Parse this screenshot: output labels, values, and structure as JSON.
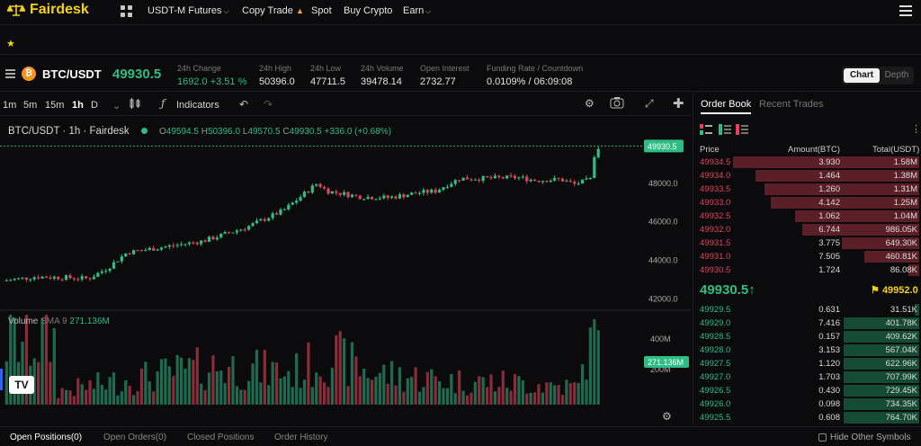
{
  "brand": {
    "name": "Fairdesk"
  },
  "nav": {
    "items": [
      {
        "label": "USDT-M Futures",
        "has_menu": true
      },
      {
        "label": "Copy Trade",
        "badge_icon": "fire-icon"
      },
      {
        "label": "Spot"
      },
      {
        "label": "Buy Crypto"
      },
      {
        "label": "Earn",
        "has_menu": true
      }
    ]
  },
  "ticker": {
    "pair": "BTC/USDT",
    "last_price": "49930.5",
    "stats": [
      {
        "label": "24h Change",
        "value": "1692.0 +3.51 %"
      },
      {
        "label": "24h High",
        "value": "50396.0"
      },
      {
        "label": "24h Low",
        "value": "47711.5"
      },
      {
        "label": "24h Volume",
        "value": "39478.14"
      },
      {
        "label": "Open Interest",
        "value": "2732.77"
      },
      {
        "label": "Funding Rate / Countdown",
        "value": "0.0109% / 06:09:08"
      }
    ],
    "view_toggle": {
      "active": "Chart",
      "inactive": "Depth"
    }
  },
  "toolbar": {
    "timeframes": [
      "1m",
      "5m",
      "15m",
      "1h",
      "D"
    ],
    "active_timeframe": "1h",
    "indicators_label": "Indicators"
  },
  "chart": {
    "title": "BTC/USDT · 1h · Fairdesk",
    "ohlc": {
      "o": "49594.5",
      "h": "50396.0",
      "l": "49570.5",
      "c": "49930.5",
      "change": "+336.0 (+0.68%)"
    },
    "price_tag": "49930.5",
    "volume_tag": "271.136M",
    "volume_label": "Volume",
    "volume_sma": "SMA 9",
    "volume_value": "271.136M",
    "tv_logo": "TV",
    "colors": {
      "up": "#2ebd85",
      "down": "#e0445b"
    }
  },
  "chart_data": {
    "type": "candlestick",
    "price_axis_ticks": [
      "48000.0",
      "46000.0",
      "44000.0",
      "42000.0"
    ],
    "volume_axis_ticks": [
      "400M",
      "200M"
    ],
    "x_ticks": [
      "7",
      "8",
      "9",
      "10",
      "11",
      "12",
      "13"
    ],
    "ylim": [
      41600,
      50600
    ],
    "xlim": [
      6.45,
      13.15
    ],
    "anchors": [
      [
        6.47,
        42950
      ],
      [
        6.8,
        43150
      ],
      [
        7.15,
        43100
      ],
      [
        7.35,
        43050
      ],
      [
        7.55,
        43600
      ],
      [
        7.75,
        44400
      ],
      [
        8.15,
        44700
      ],
      [
        8.55,
        45000
      ],
      [
        9.0,
        45700
      ],
      [
        9.4,
        46600
      ],
      [
        9.6,
        47400
      ],
      [
        9.75,
        48000
      ],
      [
        9.85,
        47600
      ],
      [
        10.2,
        47300
      ],
      [
        10.5,
        47250
      ],
      [
        10.8,
        47500
      ],
      [
        11.0,
        47600
      ],
      [
        11.1,
        47900
      ],
      [
        11.25,
        48250
      ],
      [
        11.5,
        48250
      ],
      [
        11.85,
        48300
      ],
      [
        12.05,
        48150
      ],
      [
        12.3,
        48200
      ],
      [
        12.45,
        47950
      ],
      [
        12.62,
        48200
      ],
      [
        12.66,
        49500
      ],
      [
        12.72,
        49930.5
      ]
    ],
    "volume_series": [
      [
        7.0,
        60
      ],
      [
        7.8,
        120
      ],
      [
        8.7,
        180
      ],
      [
        9.5,
        150
      ],
      [
        9.9,
        230
      ],
      [
        10.3,
        150
      ],
      [
        11.2,
        110
      ],
      [
        12.0,
        100
      ],
      [
        12.5,
        80
      ],
      [
        12.62,
        380
      ],
      [
        12.68,
        300
      ]
    ]
  },
  "order_book": {
    "tabs": [
      "Order Book",
      "Recent Trades"
    ],
    "headers": [
      "Price",
      "Amount(BTC)",
      "Total(USDT)"
    ],
    "asks": [
      {
        "price": "49934.5",
        "amount": "3.930",
        "total": "1.58M",
        "depth": 0.84
      },
      {
        "price": "49934.0",
        "amount": "1.464",
        "total": "1.38M",
        "depth": 0.74
      },
      {
        "price": "49933.5",
        "amount": "1.260",
        "total": "1.31M",
        "depth": 0.7
      },
      {
        "price": "49933.0",
        "amount": "4.142",
        "total": "1.25M",
        "depth": 0.67
      },
      {
        "price": "49932.5",
        "amount": "1.062",
        "total": "1.04M",
        "depth": 0.56
      },
      {
        "price": "49932.0",
        "amount": "6.744",
        "total": "986.05K",
        "depth": 0.53
      },
      {
        "price": "49931.5",
        "amount": "3.775",
        "total": "649.30K",
        "depth": 0.35
      },
      {
        "price": "49931.0",
        "amount": "7.505",
        "total": "460.81K",
        "depth": 0.25
      },
      {
        "price": "49930.5",
        "amount": "1.724",
        "total": "86.08K",
        "depth": 0.05
      }
    ],
    "mid_price": "49930.5↑",
    "mark_price": "49952.0",
    "bids": [
      {
        "price": "49929.5",
        "amount": "0.631",
        "total": "31.51K",
        "depth": 0.02
      },
      {
        "price": "49929.0",
        "amount": "7.416",
        "total": "401.78K",
        "depth": 0.34
      },
      {
        "price": "49928.5",
        "amount": "0.157",
        "total": "409.62K",
        "depth": 0.34
      },
      {
        "price": "49928.0",
        "amount": "3.153",
        "total": "567.04K",
        "depth": 0.34
      },
      {
        "price": "49927.5",
        "amount": "1.120",
        "total": "622.96K",
        "depth": 0.34
      },
      {
        "price": "49927.0",
        "amount": "1.703",
        "total": "707.99K",
        "depth": 0.34
      },
      {
        "price": "49926.5",
        "amount": "0.430",
        "total": "729.45K",
        "depth": 0.34
      },
      {
        "price": "49926.0",
        "amount": "0.098",
        "total": "734.35K",
        "depth": 0.34
      },
      {
        "price": "49925.5",
        "amount": "0.608",
        "total": "764.70K",
        "depth": 0.34
      }
    ]
  },
  "bottom_tabs": [
    "Open Positions(0)",
    "Open Orders(0)",
    "Closed Positions",
    "Order History"
  ],
  "hide_other_symbols_label": "Hide Other Symbols"
}
